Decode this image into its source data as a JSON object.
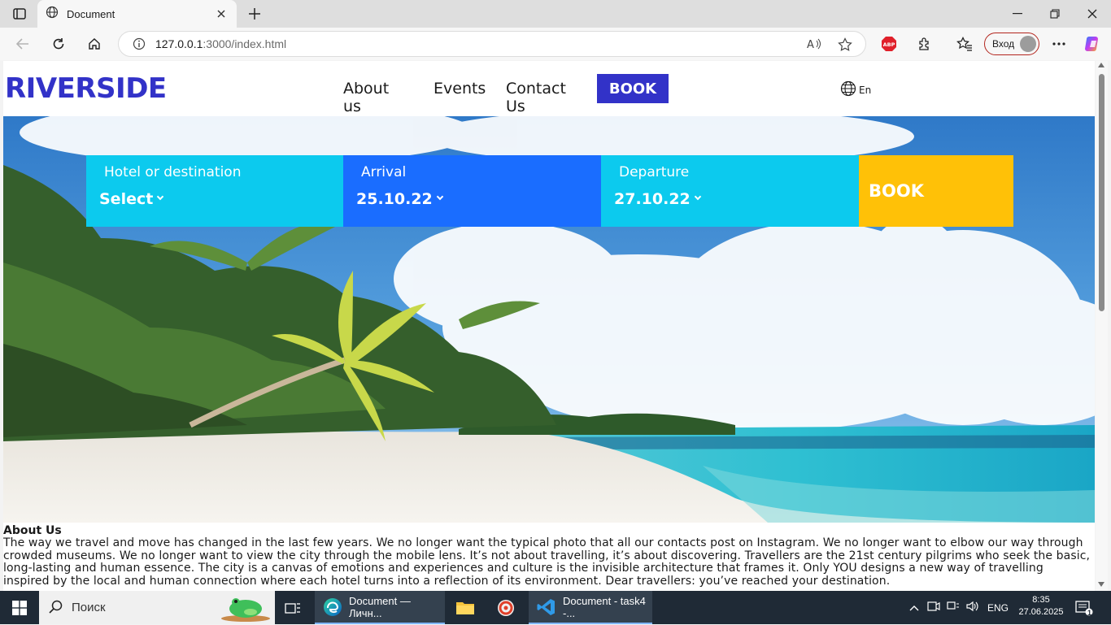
{
  "browser": {
    "tab_title": "Document",
    "url_host": "127.0.0.1",
    "url_path": ":3000/index.html",
    "signin_label": "Вход",
    "icons": [
      "tab-actions-icon",
      "globe-icon",
      "close-icon",
      "plus-icon",
      "minimize-icon",
      "maximize-icon",
      "back-icon",
      "refresh-icon",
      "home-icon",
      "info-icon",
      "read-aloud-icon",
      "favorite-icon",
      "adblock-icon",
      "extensions-icon",
      "favorites-list-icon",
      "more-icon",
      "copilot-icon"
    ]
  },
  "site": {
    "logo": "RIVERSIDE",
    "menu": {
      "about": "About us",
      "events": "Events",
      "contact": "Contact Us",
      "book": "BOOK"
    },
    "lang": "En",
    "booking": {
      "hotel_label": "Hotel or destination",
      "hotel_value": "Select",
      "arrival_label": "Arrival",
      "arrival_value": "25.10.22",
      "departure_label": "Departure",
      "departure_value": "27.10.22",
      "book": "BOOK"
    },
    "colors": {
      "brand": "#3232c8",
      "cell_cyan": "#0ccaee",
      "cell_blue": "#1a6dff",
      "book_yellow": "#ffc107"
    },
    "about": {
      "title": "About Us",
      "body": "The way we travel and move has changed in the last few years. We no longer want the typical photo that all our contacts post on Instagram. We no longer want to elbow our way through crowded museums. We no longer want to view the city through the mobile lens. It’s not about travelling, it’s about discovering. Travellers are the 21st century pilgrims who seek the basic, long-lasting and human essence. The city is a canvas of emotions and experiences and culture is the invisible architecture that frames it. Only YOU designs a new way of travelling inspired by the local and human connection where each hotel turns into a reflection of its environment. Dear travellers: you’ve reached your destination."
    }
  },
  "taskbar": {
    "search_placeholder": "Поиск",
    "apps": [
      {
        "label": "Document — Личн..."
      },
      {
        "label": "Document - task4 -..."
      }
    ],
    "lang": "ENG",
    "time": "8:35",
    "date": "27.06.2025",
    "notifications": "1"
  }
}
